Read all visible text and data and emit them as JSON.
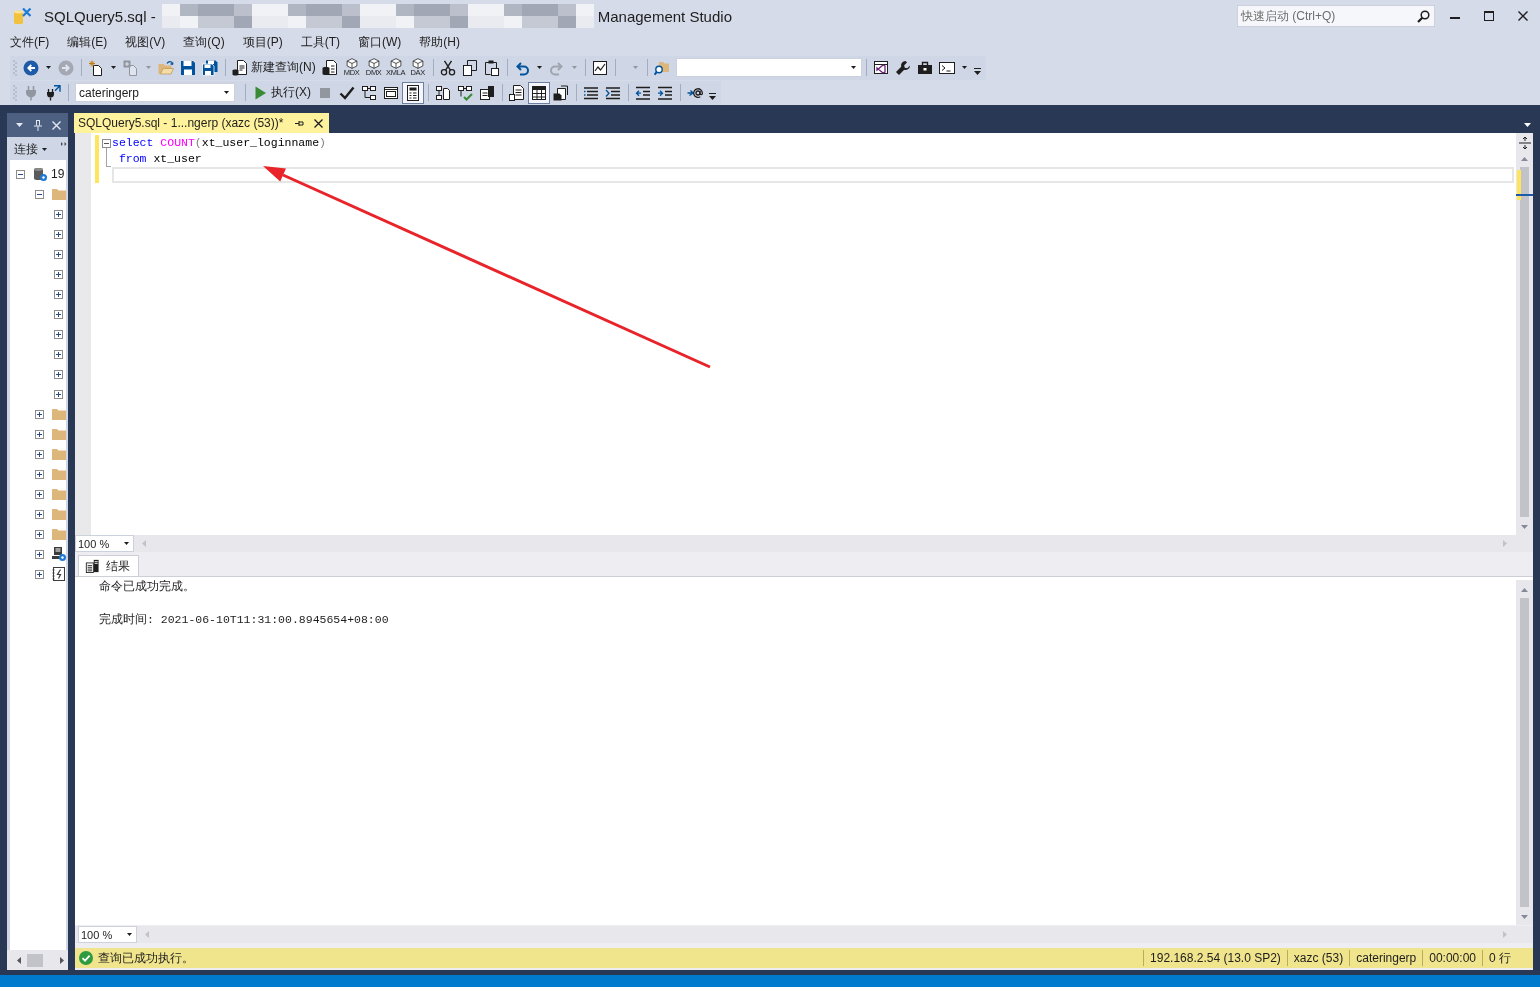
{
  "window": {
    "title_start": "SQLQuery5.sql -",
    "title_end": "Management Studio",
    "quick_launch": {
      "placeholder": "快速启动 (Ctrl+Q)"
    }
  },
  "menu": [
    "文件(F)",
    "编辑(E)",
    "视图(V)",
    "查询(Q)",
    "项目(P)",
    "工具(T)",
    "窗口(W)",
    "帮助(H)"
  ],
  "toolbars": [
    {
      "items": [
        {
          "kind": "split",
          "disabled": false
        },
        {
          "kind": "button",
          "disabled": true
        },
        {
          "kind": "separator"
        },
        {
          "kind": "split",
          "disabled": false
        },
        {
          "kind": "split",
          "disabled": true
        },
        {
          "kind": "button",
          "disabled": false
        },
        {
          "kind": "button",
          "disabled": false
        },
        {
          "kind": "button",
          "disabled": false
        },
        {
          "kind": "separator"
        },
        {
          "kind": "labeled",
          "label": "新建查询(N)",
          "disabled": false
        },
        {
          "kind": "button",
          "disabled": false
        },
        {
          "kind": "captioned",
          "label": "MDX",
          "disabled": false
        },
        {
          "kind": "captioned",
          "label": "DMX",
          "disabled": false
        },
        {
          "kind": "captioned",
          "label": "XMLA",
          "disabled": false
        },
        {
          "kind": "captioned",
          "label": "DAX",
          "disabled": false
        },
        {
          "kind": "separator"
        },
        {
          "kind": "button",
          "disabled": false
        },
        {
          "kind": "button",
          "disabled": false
        },
        {
          "kind": "button",
          "disabled": false
        },
        {
          "kind": "separator"
        },
        {
          "kind": "split",
          "disabled": false
        },
        {
          "kind": "split",
          "disabled": true
        },
        {
          "kind": "separator"
        },
        {
          "kind": "button",
          "disabled": false
        },
        {
          "kind": "separator"
        },
        {
          "kind": "dropdown",
          "disabled": true
        },
        {
          "kind": "separator"
        },
        {
          "kind": "button",
          "disabled": false
        },
        {
          "kind": "combo"
        },
        {
          "kind": "separator"
        },
        {
          "kind": "button",
          "disabled": false
        },
        {
          "kind": "button",
          "disabled": false
        },
        {
          "kind": "button",
          "disabled": false
        },
        {
          "kind": "split",
          "disabled": false
        }
      ]
    },
    {
      "items": [
        {
          "kind": "button",
          "disabled": true
        },
        {
          "kind": "button",
          "disabled": false
        },
        {
          "kind": "separator"
        },
        {
          "kind": "combo",
          "value": "cateringerp"
        },
        {
          "kind": "separator"
        },
        {
          "kind": "labeled",
          "label": "执行(X)",
          "disabled": false
        },
        {
          "kind": "button",
          "disabled": true
        },
        {
          "kind": "button",
          "disabled": false
        },
        {
          "kind": "button",
          "disabled": false
        },
        {
          "kind": "button",
          "disabled": false
        },
        {
          "kind": "toggle",
          "pressed": true,
          "disabled": false
        },
        {
          "kind": "separator"
        },
        {
          "kind": "button",
          "disabled": false
        },
        {
          "kind": "button",
          "disabled": false
        },
        {
          "kind": "button",
          "disabled": false
        },
        {
          "kind": "separator"
        },
        {
          "kind": "toggle",
          "pressed": false,
          "disabled": false
        },
        {
          "kind": "toggle",
          "pressed": true,
          "disabled": false
        },
        {
          "kind": "toggle",
          "pressed": false,
          "disabled": false
        },
        {
          "kind": "separator"
        },
        {
          "kind": "button",
          "disabled": false
        },
        {
          "kind": "button",
          "disabled": false
        },
        {
          "kind": "separator"
        },
        {
          "kind": "button",
          "disabled": false
        },
        {
          "kind": "button",
          "disabled": false
        },
        {
          "kind": "separator"
        },
        {
          "kind": "button",
          "disabled": false
        }
      ]
    }
  ],
  "object_explorer": {
    "connect_label": "连接",
    "tree": [
      {
        "kind": "database",
        "label": "19",
        "expanded": true,
        "children": [
          {
            "kind": "folder",
            "expanded": true,
            "children": [
              {
                "expanded": false
              },
              {
                "expanded": false
              },
              {
                "expanded": false
              },
              {
                "expanded": false
              },
              {
                "expanded": false
              },
              {
                "expanded": false
              },
              {
                "expanded": false
              },
              {
                "expanded": false
              },
              {
                "expanded": false
              },
              {
                "expanded": false
              }
            ]
          },
          {
            "kind": "folder",
            "expanded": false
          },
          {
            "kind": "folder",
            "expanded": false
          },
          {
            "kind": "folder",
            "expanded": false
          },
          {
            "kind": "folder",
            "expanded": false
          },
          {
            "kind": "folder",
            "expanded": false
          },
          {
            "kind": "folder",
            "expanded": false
          },
          {
            "kind": "folder",
            "expanded": false
          },
          {
            "kind": "agent",
            "expanded": false
          },
          {
            "kind": "xevents",
            "expanded": false
          }
        ]
      }
    ]
  },
  "editor": {
    "tab": {
      "label": "SQLQuery5.sql - 1...ngerp (xazc (53))*",
      "selected": true
    },
    "lines": [
      {
        "changed": true,
        "current": false,
        "expanded": true,
        "tokens": [
          {
            "kind": "keyword",
            "text": "select"
          },
          {
            "kind": "function",
            "text": " COUNT"
          },
          {
            "kind": "operator",
            "text": "("
          },
          {
            "kind": "plain",
            "text": "xt_user_loginname"
          },
          {
            "kind": "operator",
            "text": ")"
          }
        ]
      },
      {
        "changed": true,
        "current": false,
        "fold_end": true,
        "tokens": [
          {
            "kind": "keyword",
            "text": " from"
          },
          {
            "kind": "plain",
            "text": " xt_user"
          }
        ]
      },
      {
        "changed": true,
        "current": true
      }
    ],
    "zoom": "100 %"
  },
  "results": {
    "tab": {
      "label": "结果",
      "selected": true
    },
    "messages": [
      "命令已成功完成。",
      "完成时间: 2021-06-10T11:31:00.8945654+08:00"
    ],
    "zoom": "100 %"
  },
  "status_bar": {
    "succeeded": true,
    "message": "查询已成功执行。",
    "segments": [
      "192.168.2.54 (13.0 SP2)",
      "xazc (53)",
      "cateringerp",
      "00:00:00",
      "0 行"
    ]
  },
  "annotations": [
    {
      "kind": "arrow"
    }
  ]
}
